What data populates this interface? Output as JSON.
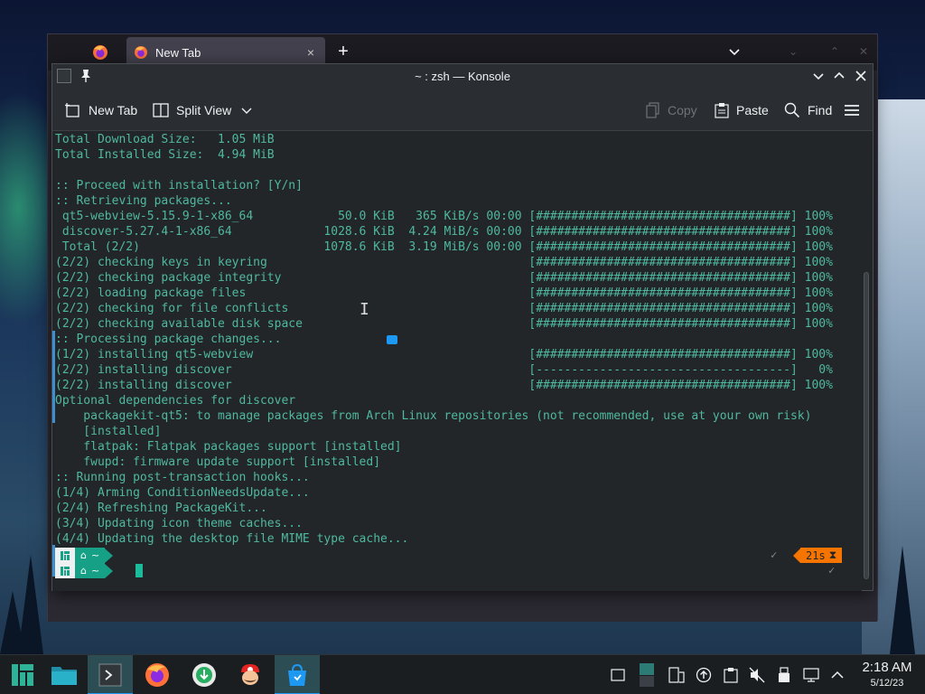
{
  "browser": {
    "tab_label": "New Tab",
    "tab_close": "×",
    "new_tab_symbol": "+"
  },
  "konsole": {
    "title": "~ : zsh — Konsole",
    "toolbar": {
      "new_tab": "New Tab",
      "split_view": "Split View",
      "copy": "Copy",
      "paste": "Paste",
      "find": "Find"
    },
    "lines": [
      "Total Download Size:   1.05 MiB",
      "Total Installed Size:  4.94 MiB",
      "",
      ":: Proceed with installation? [Y/n]",
      ":: Retrieving packages...",
      " qt5-webview-5.15.9-1-x86_64            50.0 KiB   365 KiB/s 00:00 [####################################] 100%",
      " discover-5.27.4-1-x86_64             1028.6 KiB  4.24 MiB/s 00:00 [####################################] 100%",
      " Total (2/2)                          1078.6 KiB  3.19 MiB/s 00:00 [####################################] 100%",
      "(2/2) checking keys in keyring                                     [####################################] 100%",
      "(2/2) checking package integrity                                   [####################################] 100%",
      "(2/2) loading package files                                        [####################################] 100%",
      "(2/2) checking for file conflicts                                  [####################################] 100%",
      "(2/2) checking available disk space                                [####################################] 100%",
      ":: Processing package changes...",
      "(1/2) installing qt5-webview                                       [####################################] 100%",
      "(2/2) installing discover                                          [------------------------------------]   0%",
      "(2/2) installing discover                                          [####################################] 100%",
      "Optional dependencies for discover",
      "    packagekit-qt5: to manage packages from Arch Linux repositories (not recommended, use at your own risk)",
      "    [installed]",
      "    flatpak: Flatpak packages support [installed]",
      "    fwupd: firmware update support [installed]",
      ":: Running post-transaction hooks...",
      "(1/4) Arming ConditionNeedsUpdate...",
      "(2/4) Refreshing PackageKit...",
      "(3/4) Updating icon theme caches...",
      "(4/4) Updating the desktop file MIME type cache..."
    ],
    "prompt": {
      "path": "~",
      "elapsed": "21s",
      "check": "✓"
    }
  },
  "taskbar": {
    "time": "2:18 AM",
    "date": "5/12/23"
  },
  "colors": {
    "accent": "#1d99f3",
    "terminal_text": "#4fb8a0",
    "prompt_green": "#16a085",
    "prompt_orange": "#f67400"
  }
}
